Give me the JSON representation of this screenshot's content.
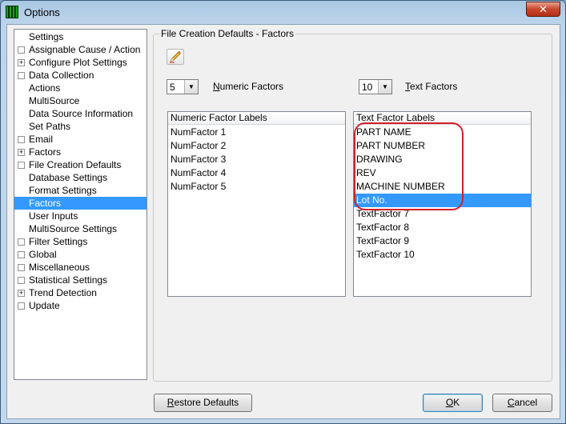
{
  "window": {
    "title": "Options",
    "close_glyph": "✕"
  },
  "tree": {
    "header": "Settings",
    "items": [
      {
        "label": "Assignable Cause / Action",
        "expander": ""
      },
      {
        "label": "Configure Plot Settings",
        "expander": "+"
      },
      {
        "label": "Data Collection",
        "expander": ""
      },
      {
        "label": "Actions",
        "expander": null
      },
      {
        "label": "MultiSource",
        "expander": null
      },
      {
        "label": "Data Source Information",
        "expander": null
      },
      {
        "label": "Set Paths",
        "expander": null
      },
      {
        "label": "Email",
        "expander": ""
      },
      {
        "label": "Factors",
        "expander": "+"
      },
      {
        "label": "File Creation Defaults",
        "expander": ""
      },
      {
        "label": "Database Settings",
        "expander": null
      },
      {
        "label": "Format Settings",
        "expander": null
      },
      {
        "label": "Factors",
        "expander": null
      },
      {
        "label": "User Inputs",
        "expander": null
      },
      {
        "label": "MultiSource Settings",
        "expander": null
      },
      {
        "label": "Filter Settings",
        "expander": ""
      },
      {
        "label": "Global",
        "expander": ""
      },
      {
        "label": "Miscellaneous",
        "expander": ""
      },
      {
        "label": "Statistical Settings",
        "expander": ""
      },
      {
        "label": "Trend Detection",
        "expander": "+"
      },
      {
        "label": "Update",
        "expander": ""
      }
    ],
    "selected_index": 12
  },
  "group": {
    "title": "File Creation Defaults - Factors"
  },
  "numeric_factors": {
    "count": "5",
    "label_prefix": "",
    "label_accel": "N",
    "label_rest": "umeric Factors"
  },
  "text_factors": {
    "count": "10",
    "label_accel": "T",
    "label_rest": "ext Factors"
  },
  "numeric_list": {
    "header": "Numeric Factor Labels",
    "rows": [
      "NumFactor 1",
      "NumFactor 2",
      "NumFactor 3",
      "NumFactor 4",
      "NumFactor 5"
    ]
  },
  "text_list": {
    "header": "Text Factor Labels",
    "rows": [
      "PART NAME",
      "PART NUMBER",
      "DRAWING",
      "REV",
      "MACHINE NUMBER",
      "Lot No.",
      "TextFactor 7",
      "TextFactor 8",
      "TextFactor 9",
      "TextFactor 10"
    ],
    "selected_index": 5
  },
  "buttons": {
    "restore_accel": "R",
    "restore_rest": "estore Defaults",
    "ok_accel": "O",
    "ok_rest": "K",
    "cancel_accel": "C",
    "cancel_rest": "ancel"
  },
  "icons": {
    "app": "app-grid-icon",
    "pencil": "pencil-icon",
    "dropdown": "▼"
  }
}
